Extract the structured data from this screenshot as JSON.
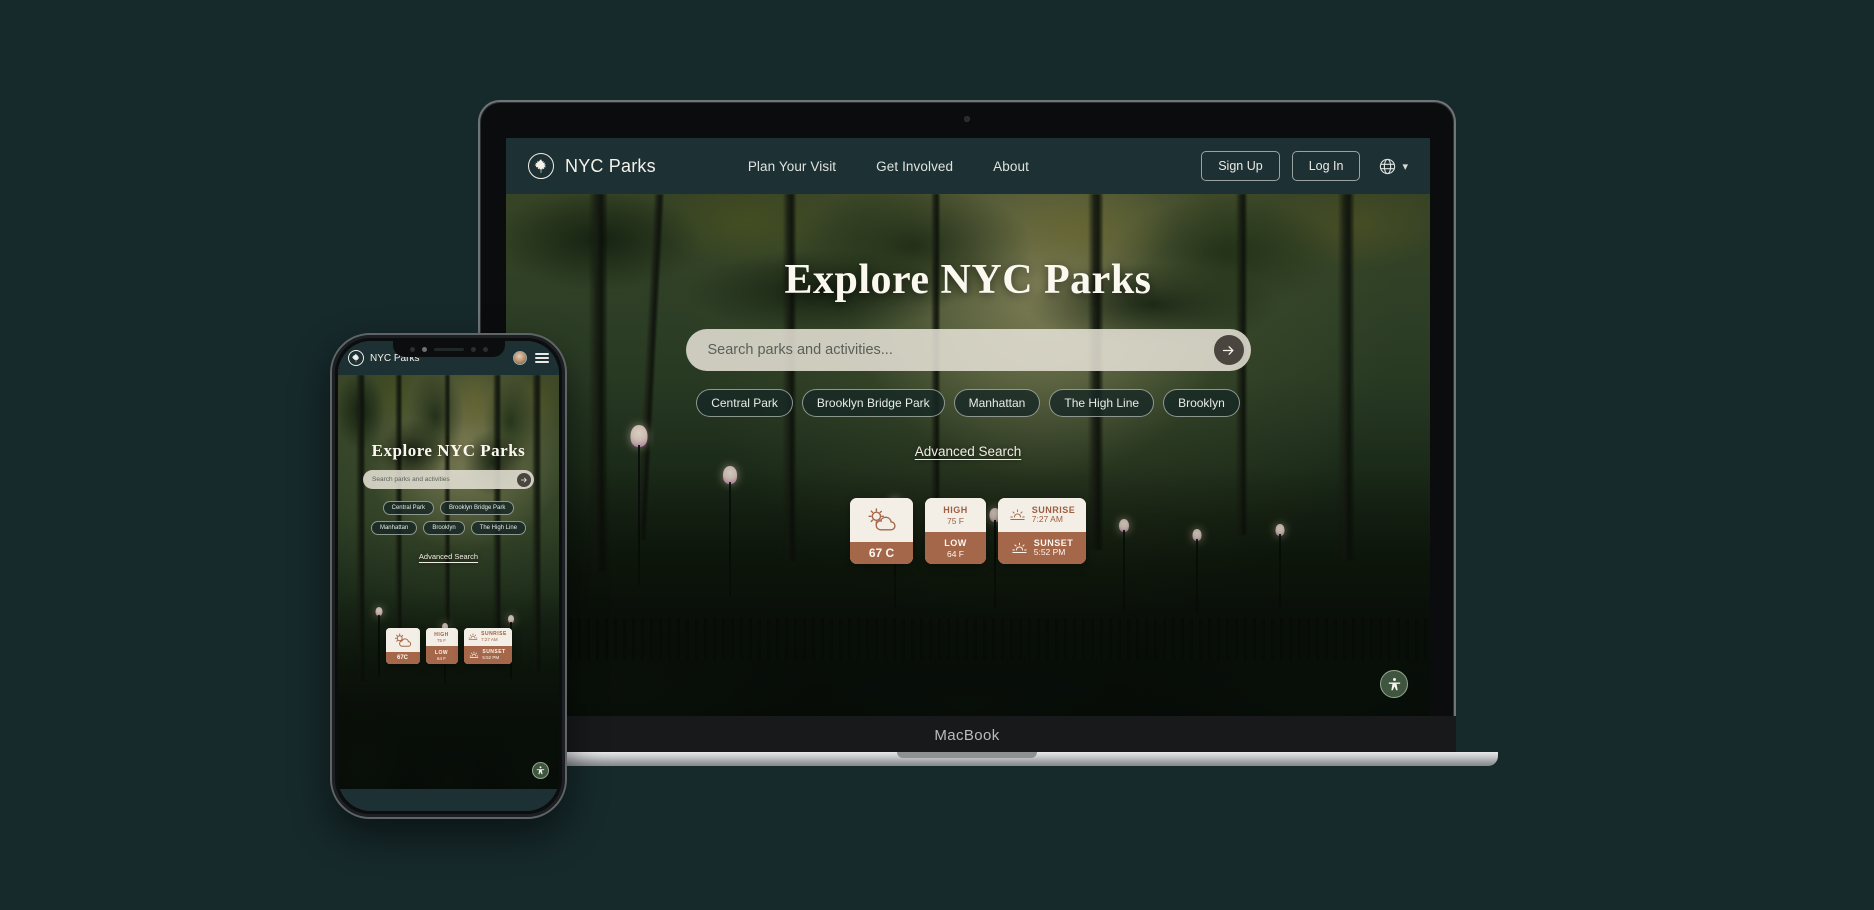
{
  "page": {
    "background_color": "#16292b"
  },
  "device_laptop": {
    "name": "MacBook",
    "label": "MacBook"
  },
  "site": {
    "brand": {
      "name": "NYC Parks",
      "logo_icon": "maple-leaf-icon"
    },
    "nav_links": [
      {
        "label": "Plan Your Visit"
      },
      {
        "label": "Get Involved"
      },
      {
        "label": "About"
      }
    ],
    "actions": {
      "sign_up": "Sign Up",
      "log_in": "Log In",
      "language_icon": "globe-icon",
      "language_chevron": "chevron-down-icon"
    },
    "hero": {
      "title": "Explore NYC Parks",
      "search_placeholder": "Search parks and activities...",
      "search_value": "",
      "search_button_icon": "arrow-right-icon",
      "chips": [
        "Central Park",
        "Brooklyn Bridge Park",
        "Manhattan",
        "The High Line",
        "Brooklyn"
      ],
      "advanced_search": "Advanced Search"
    },
    "weather": {
      "current": {
        "icon": "sun-cloud-icon",
        "temperature": "67 C"
      },
      "high": {
        "label": "HIGH",
        "value": "75 F"
      },
      "low": {
        "label": "LOW",
        "value": "64 F"
      },
      "sunrise": {
        "icon": "sunrise-icon",
        "label": "SUNRISE",
        "value": "7:27 AM"
      },
      "sunset": {
        "icon": "sunset-icon",
        "label": "SUNSET",
        "value": "5:52 PM"
      }
    },
    "accessibility_button": {
      "icon": "accessibility-person-icon",
      "color": "#3f5540"
    }
  },
  "mobile": {
    "brand": {
      "name": "NYC Parks",
      "logo_icon": "maple-leaf-icon"
    },
    "nav": {
      "avatar_icon": "user-avatar",
      "menu_icon": "hamburger-menu-icon"
    },
    "hero": {
      "title": "Explore NYC Parks",
      "search_placeholder": "Search parks and activities",
      "search_value": "",
      "search_button_icon": "arrow-right-icon",
      "chips_row1": [
        "Central Park",
        "Brooklyn Bridge Park"
      ],
      "chips_row2": [
        "Manhattan",
        "Brooklyn",
        "The High Line"
      ],
      "advanced_search": "Advanced Search"
    },
    "weather": {
      "current": {
        "icon": "sun-cloud-icon",
        "temperature": "67C"
      },
      "high": {
        "label": "HIGH",
        "value": "75 F"
      },
      "low": {
        "label": "LOW",
        "value": "64 F"
      },
      "sunrise": {
        "icon": "sunrise-icon",
        "label": "SUNRISE",
        "value": "7:27 AM"
      },
      "sunset": {
        "icon": "sunset-icon",
        "label": "SUNSET",
        "value": "5:52 PM"
      }
    },
    "accessibility_button": {
      "icon": "accessibility-person-icon"
    }
  },
  "colors": {
    "nav_background": "#1d3033",
    "accent_terracotta": "#a4674a",
    "card_cream": "#f3efe6"
  }
}
